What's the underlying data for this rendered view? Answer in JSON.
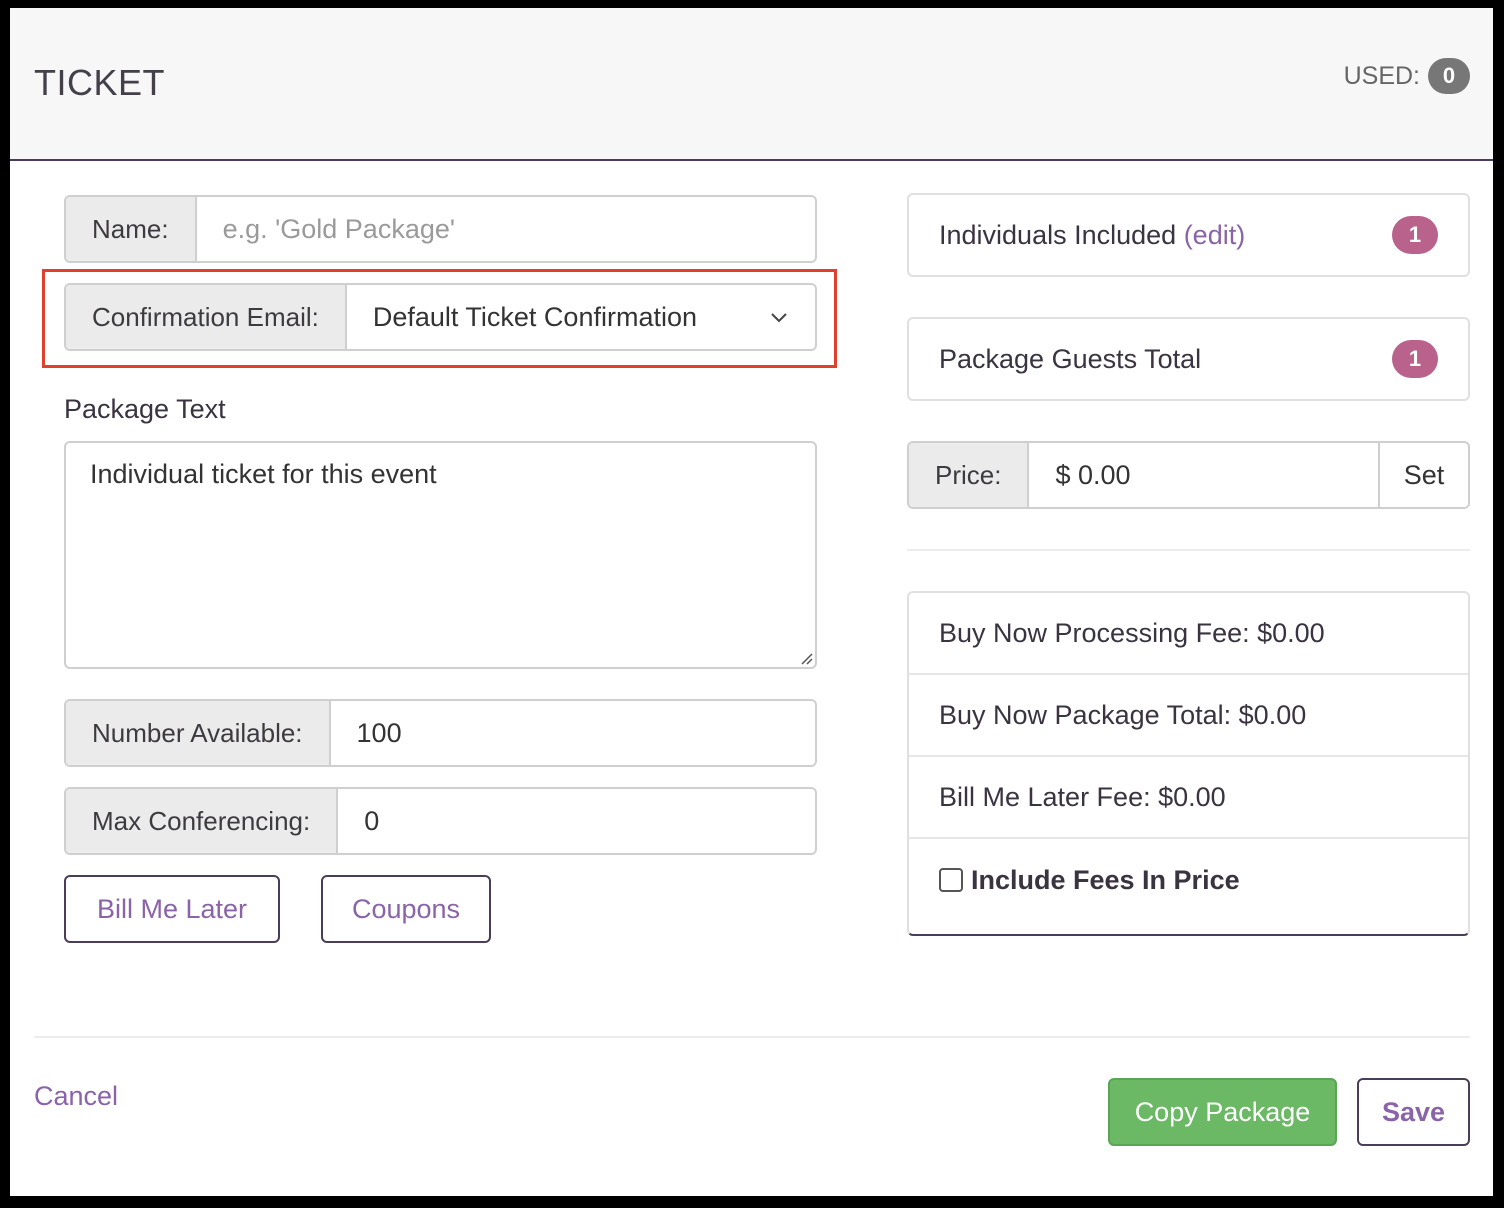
{
  "header": {
    "title": "TICKET",
    "used_label": "USED:",
    "used_count": "0"
  },
  "form": {
    "name_label": "Name:",
    "name_placeholder": "e.g. 'Gold Package'",
    "confirmation_label": "Confirmation Email:",
    "confirmation_value": "Default Ticket Confirmation",
    "package_text_label": "Package Text",
    "package_text_value": "Individual ticket for this event",
    "number_available_label": "Number Available:",
    "number_available_value": "100",
    "max_conferencing_label": "Max Conferencing:",
    "max_conferencing_value": "0",
    "bill_me_later_button": "Bill Me Later",
    "coupons_button": "Coupons"
  },
  "sidebar": {
    "individuals_label": "Individuals Included",
    "individuals_edit": "(edit)",
    "individuals_count": "1",
    "guests_label": "Package Guests Total",
    "guests_count": "1",
    "price_label": "Price:",
    "price_value": "$ 0.00",
    "set_button": "Set",
    "fees": {
      "processing_fee": "Buy Now Processing Fee: $0.00",
      "package_total": "Buy Now Package Total: $0.00",
      "bill_later_fee": "Bill Me Later Fee: $0.00",
      "include_fees_label": "Include Fees In Price"
    }
  },
  "footer": {
    "cancel": "Cancel",
    "copy_package": "Copy Package",
    "save": "Save"
  },
  "colors": {
    "accent_purple": "#8a63a8",
    "badge_pink": "#b9628c",
    "success_green": "#6bb865",
    "highlight_red": "#e0412c"
  }
}
